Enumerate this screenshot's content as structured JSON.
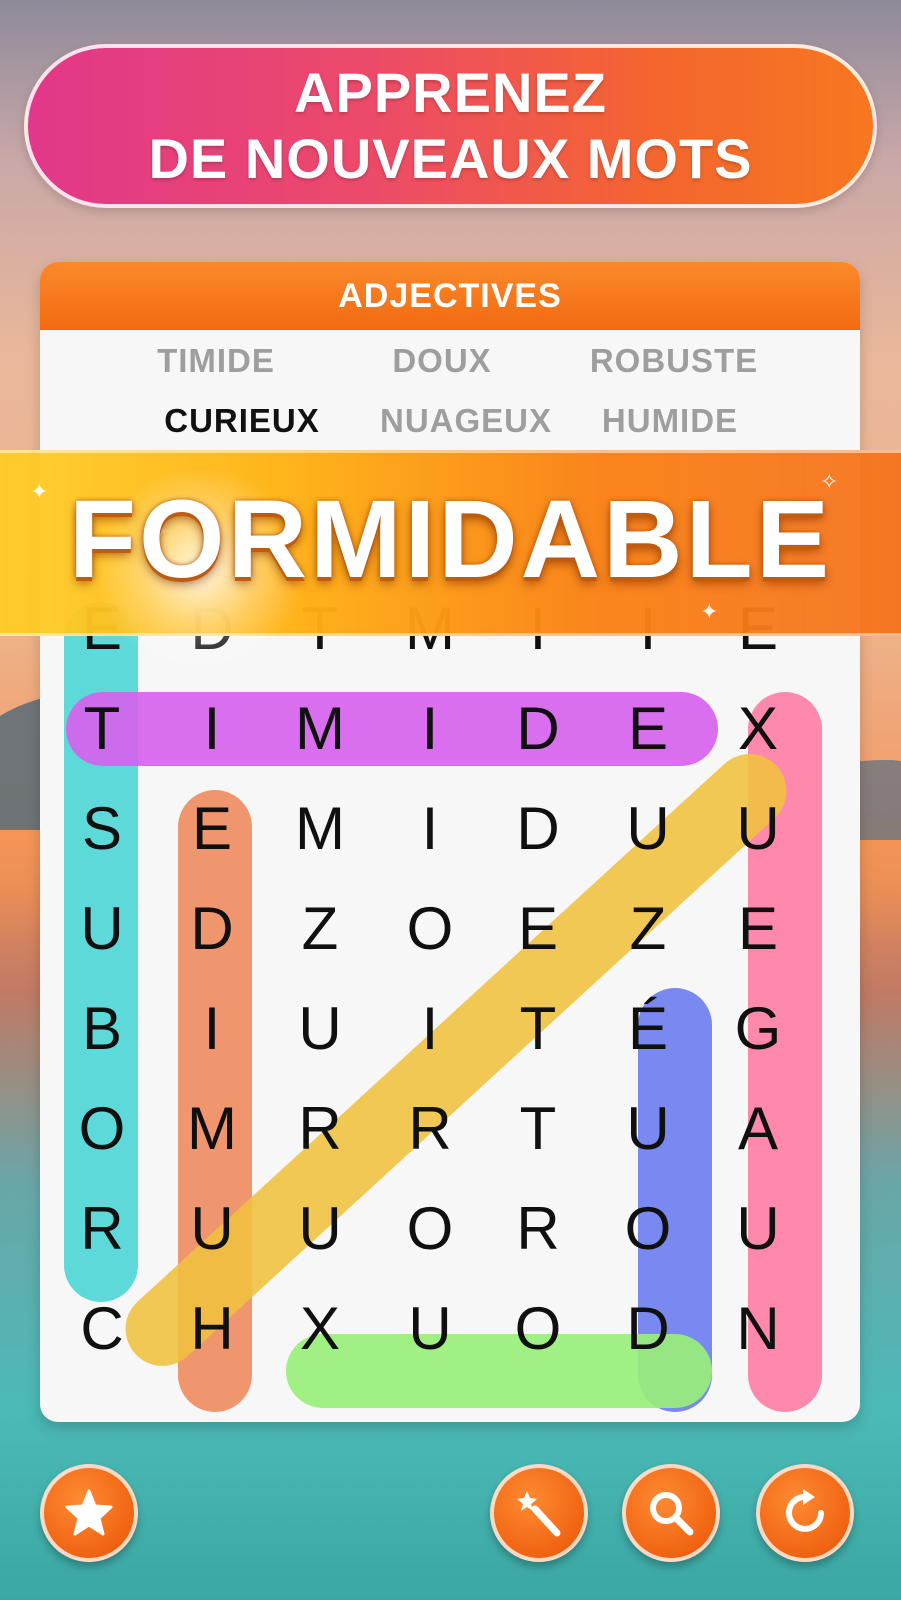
{
  "header": {
    "line1": "APPRENEZ",
    "line2": "DE NOUVEAUX MOTS"
  },
  "board": {
    "category": "ADJECTIVES",
    "words": [
      {
        "text": "TIMIDE",
        "found": true
      },
      {
        "text": "DOUX",
        "found": true
      },
      {
        "text": "ROBUSTE",
        "found": true
      },
      {
        "text": "CURIEUX",
        "found": false
      },
      {
        "text": "NUAGEUX",
        "found": true
      },
      {
        "text": "HUMIDE",
        "found": true
      }
    ],
    "grid": [
      [
        "E",
        "D",
        "T",
        "M",
        "I",
        "I",
        "E"
      ],
      [
        "T",
        "I",
        "M",
        "I",
        "D",
        "E",
        "X"
      ],
      [
        "S",
        "E",
        "M",
        "I",
        "D",
        "U",
        "U"
      ],
      [
        "U",
        "D",
        "Z",
        "O",
        "E",
        "Z",
        "E"
      ],
      [
        "B",
        "I",
        "U",
        "I",
        "T",
        "É",
        "G"
      ],
      [
        "O",
        "M",
        "R",
        "R",
        "T",
        "U",
        "A"
      ],
      [
        "R",
        "U",
        "U",
        "O",
        "R",
        "O",
        "U"
      ],
      [
        "C",
        "H",
        "X",
        "U",
        "O",
        "D",
        "N"
      ]
    ]
  },
  "banner": {
    "text": "FORMIDABLE"
  },
  "toolbar": {
    "favorite_icon": "star-icon",
    "hint_icon": "magic-wand-icon",
    "search_icon": "magnifier-icon",
    "restart_icon": "refresh-icon"
  },
  "colors": {
    "header_start": "#e2378a",
    "header_end": "#f7771f",
    "category_bar": "#f26a10",
    "button": "#f06412"
  }
}
